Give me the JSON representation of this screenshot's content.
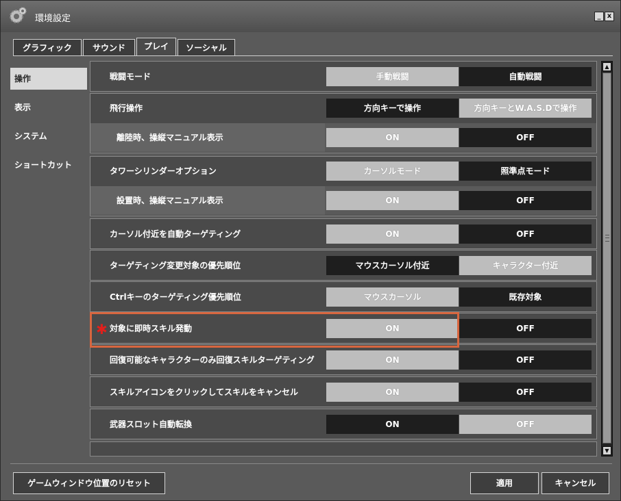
{
  "window": {
    "title": "環境設定",
    "min_label": "_",
    "close_label": "x"
  },
  "tabs": [
    {
      "label": "グラフィック"
    },
    {
      "label": "サウンド"
    },
    {
      "label": "プレイ",
      "active": true
    },
    {
      "label": "ソーシャル"
    }
  ],
  "sidebar": {
    "items": [
      {
        "label": "操作",
        "active": true
      },
      {
        "label": "表示"
      },
      {
        "label": "システム"
      },
      {
        "label": "ショートカット"
      }
    ]
  },
  "settings": [
    {
      "label": "戦闘モード",
      "options": [
        "手動戦闘",
        "自動戦闘"
      ],
      "selected": 1
    },
    {
      "label": "飛行操作",
      "options": [
        "方向キーで操作",
        "方向キーとW.A.S.Dで操作"
      ],
      "selected": 0
    },
    {
      "label": "離陸時、操縦マニュアル表示",
      "options": [
        "ON",
        "OFF"
      ],
      "selected": 1
    },
    {
      "label": "タワーシリンダーオプション",
      "options": [
        "カーソルモード",
        "照準点モード"
      ],
      "selected": 1
    },
    {
      "label": "設置時、操縦マニュアル表示",
      "options": [
        "ON",
        "OFF"
      ],
      "selected": 1
    },
    {
      "label": "カーソル付近を自動ターゲティング",
      "options": [
        "ON",
        "OFF"
      ],
      "selected": 1
    },
    {
      "label": "ターゲティング変更対象の優先順位",
      "options": [
        "マウスカーソル付近",
        "キャラクター付近"
      ],
      "selected": 0
    },
    {
      "label": "Ctrlキーのターゲティング優先順位",
      "options": [
        "マウスカーソル",
        "既存対象"
      ],
      "selected": 1
    },
    {
      "label": "対象に即時スキル発動",
      "options": [
        "ON",
        "OFF"
      ],
      "selected": 1,
      "marker": "✱"
    },
    {
      "label": "回復可能なキャラクターのみ回復スキルターゲティング",
      "options": [
        "ON",
        "OFF"
      ],
      "selected": 1
    },
    {
      "label": "スキルアイコンをクリックしてスキルをキャンセル",
      "options": [
        "ON",
        "OFF"
      ],
      "selected": 1
    },
    {
      "label": "武器スロット自動転換",
      "options": [
        "ON",
        "OFF"
      ],
      "selected": 0
    }
  ],
  "scrollbar": {
    "up": "▲",
    "down": "▼"
  },
  "footer": {
    "reset_label": "ゲームウィンドウ位置のリセット",
    "apply_label": "適用",
    "cancel_label": "キャンセル"
  },
  "colors": {
    "highlight": "#d8663f",
    "marker": "#e0201c",
    "selected": "#1e1e1e",
    "unselected": "#bdbdbd"
  }
}
